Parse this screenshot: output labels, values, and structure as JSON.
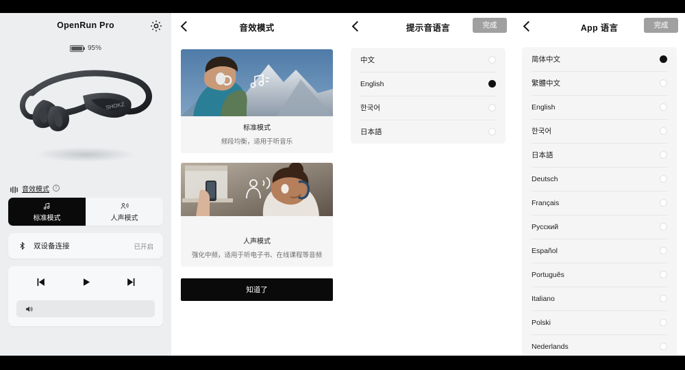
{
  "panel_device": {
    "title": "OpenRun Pro",
    "gear_icon": "gear-icon",
    "battery": {
      "percent_label": "95%",
      "level": 95
    },
    "product_image_alt": "shokz-openrun-pro-headphone",
    "sound_mode_link": {
      "label": "音效模式",
      "eq_icon": "equalizer-icon",
      "info_icon": "info-icon"
    },
    "segmented": {
      "items": [
        {
          "label": "标准模式",
          "icon": "music-note-icon",
          "active": true
        },
        {
          "label": "人声模式",
          "icon": "person-voice-icon",
          "active": false
        }
      ]
    },
    "dual_device": {
      "icon": "bluetooth-icon",
      "label": "双设备连接",
      "state": "已开启"
    },
    "media": {
      "prev_icon": "skip-previous-icon",
      "play_icon": "play-icon",
      "next_icon": "skip-next-icon",
      "volume_icon": "volume-icon"
    }
  },
  "panel_sound_mode": {
    "back_icon": "chevron-left-icon",
    "title": "音效模式",
    "cards": [
      {
        "image_alt": "man-with-headphone-mountain",
        "overlay_icon": "music-note-icon",
        "title": "标准模式",
        "desc": "频段均衡，适用于听音乐"
      },
      {
        "image_alt": "woman-with-headphone-phone",
        "overlay_icon": "person-voice-icon",
        "title": "人声模式",
        "desc": "强化中频，适用于听电子书、在线课程等音频"
      }
    ],
    "confirm_label": "知道了"
  },
  "panel_prompt_language": {
    "back_icon": "chevron-left-icon",
    "title": "提示音语言",
    "done_label": "完成",
    "options": [
      {
        "label": "中文",
        "selected": false
      },
      {
        "label": "English",
        "selected": true
      },
      {
        "label": "한국어",
        "selected": false
      },
      {
        "label": "日本語",
        "selected": false
      }
    ]
  },
  "panel_app_language": {
    "back_icon": "chevron-left-icon",
    "title": "App 语言",
    "done_label": "完成",
    "options": [
      {
        "label": "简体中文",
        "selected": true
      },
      {
        "label": "繁體中文",
        "selected": false
      },
      {
        "label": "English",
        "selected": false
      },
      {
        "label": "한국어",
        "selected": false
      },
      {
        "label": "日本語",
        "selected": false
      },
      {
        "label": "Deutsch",
        "selected": false
      },
      {
        "label": "Français",
        "selected": false
      },
      {
        "label": "Русский",
        "selected": false
      },
      {
        "label": "Español",
        "selected": false
      },
      {
        "label": "Português",
        "selected": false
      },
      {
        "label": "Italiano",
        "selected": false
      },
      {
        "label": "Polski",
        "selected": false
      },
      {
        "label": "Nederlands",
        "selected": false
      }
    ]
  },
  "colors": {
    "accent_black": "#0a0a0a",
    "panel_bg": "#eceef0",
    "card_bg": "#f5f5f5",
    "done_btn": "#a0a0a0"
  }
}
